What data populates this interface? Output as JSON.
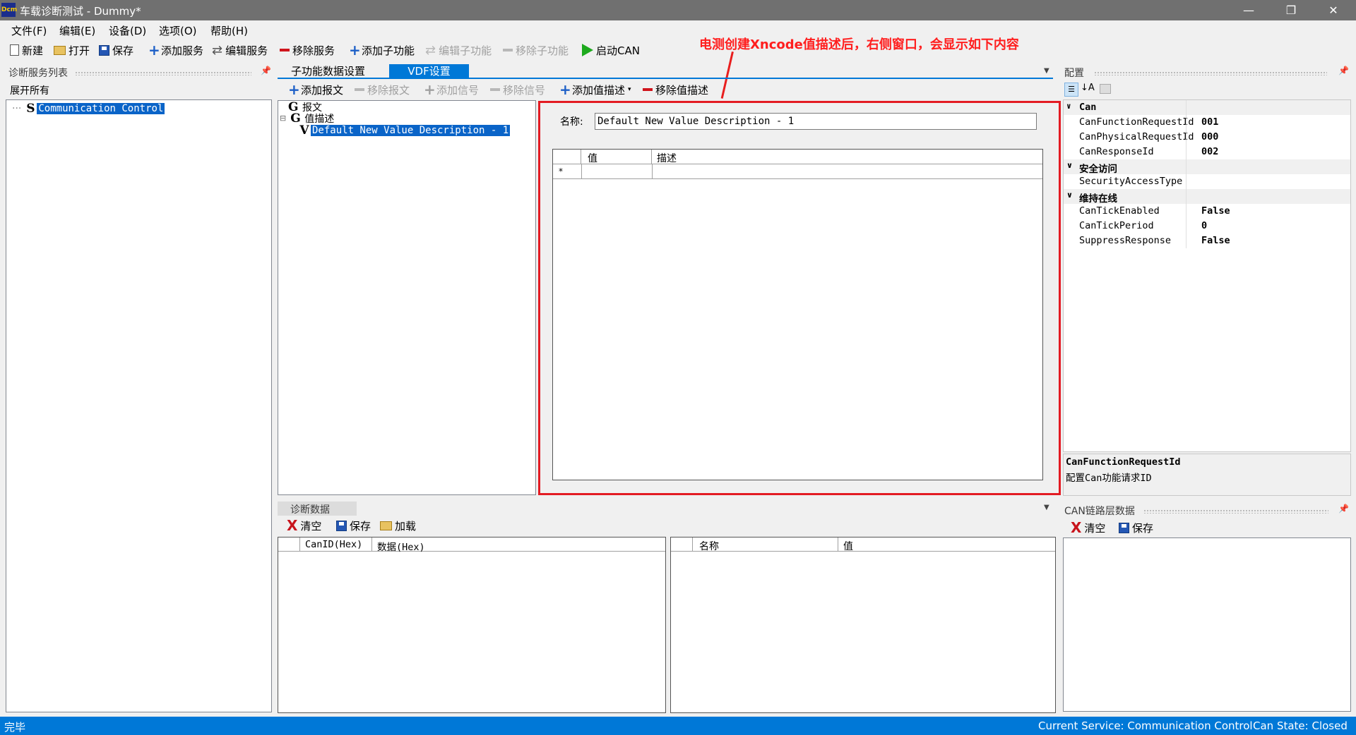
{
  "window": {
    "icon_text": "Dcm",
    "title": "车载诊断测试 - Dummy*",
    "minimize": "—",
    "restore": "❐",
    "close": "✕"
  },
  "menu": [
    "文件(F)",
    "编辑(E)",
    "设备(D)",
    "选项(O)",
    "帮助(H)"
  ],
  "toolbar": {
    "new": "新建",
    "open": "打开",
    "save": "保存",
    "add_service": "添加服务",
    "edit_service": "编辑服务",
    "remove_service": "移除服务",
    "add_subfunction": "添加子功能",
    "edit_subfunction": "编辑子功能",
    "remove_subfunction": "移除子功能",
    "start_can": "启动CAN"
  },
  "annotation": "电测创建Xncode值描述后，右侧窗口，会显示如下内容",
  "left_panel": {
    "title": "诊断服务列表",
    "expand_all": "展开所有",
    "tree": [
      {
        "icon": "S",
        "label": "Communication Control"
      }
    ]
  },
  "tabs": [
    "子功能数据设置",
    "VDF设置"
  ],
  "vdf_toolbar": {
    "add_message": "添加报文",
    "remove_message": "移除报文",
    "add_signal": "添加信号",
    "remove_signal": "移除信号",
    "add_value_desc": "添加值描述",
    "remove_value_desc": "移除值描述"
  },
  "vdf_tree": {
    "message": {
      "icon": "G",
      "label": "报文"
    },
    "value_desc": {
      "icon": "G",
      "label": "值描述",
      "toggle": "⊟"
    },
    "child": {
      "icon": "V",
      "label": "Default New Value Description - 1"
    }
  },
  "detail": {
    "name_label": "名称:",
    "name_value": "Default New Value Description - 1",
    "grid_headers": [
      "值",
      "描述"
    ],
    "new_row_marker": "*"
  },
  "config_panel": {
    "title": "配置",
    "categories": [
      {
        "name": "Can",
        "rows": [
          {
            "key": "CanFunctionRequestId",
            "value": "001"
          },
          {
            "key": "CanPhysicalRequestId",
            "value": "000"
          },
          {
            "key": "CanResponseId",
            "value": "002"
          }
        ]
      },
      {
        "name": "安全访问",
        "rows": [
          {
            "key": "SecurityAccessType",
            "value": ""
          }
        ]
      },
      {
        "name": "维持在线",
        "rows": [
          {
            "key": "CanTickEnabled",
            "value": "False"
          },
          {
            "key": "CanTickPeriod",
            "value": "0"
          },
          {
            "key": "SuppressResponse",
            "value": "False"
          }
        ]
      }
    ],
    "desc_title": "CanFunctionRequestId",
    "desc_text": "配置Can功能请求ID"
  },
  "diag_data": {
    "title": "诊断数据",
    "clear": "清空",
    "save": "保存",
    "load": "加载",
    "left_headers": [
      "CanID(Hex)",
      "数据(Hex)"
    ],
    "right_headers": [
      "名称",
      "值"
    ]
  },
  "can_panel": {
    "title": "CAN链路层数据",
    "clear": "清空",
    "save": "保存"
  },
  "status": {
    "left": "完毕",
    "service": "Current Service: Communication Control",
    "can_state": "Can State: Closed"
  }
}
